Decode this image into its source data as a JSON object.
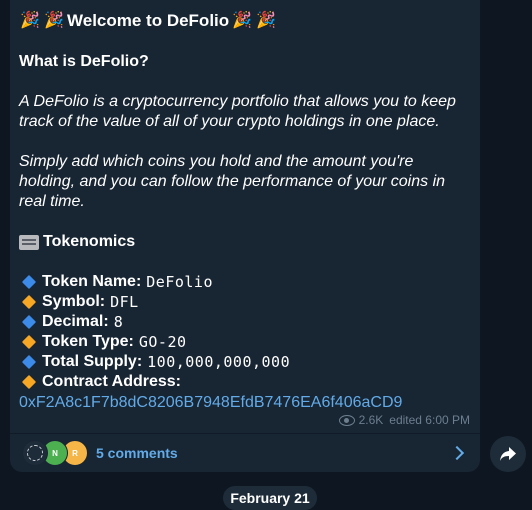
{
  "message": {
    "title_emoji": "🎉",
    "title": "Welcome to DeFolio",
    "heading": "What is DeFolio?",
    "para1": [
      "A DeFolio is a cryptocurrency portfolio that allows you to keep",
      "track of the value of all of your crypto holdings in one place."
    ],
    "para2": [
      "Simply add which coins you hold and the amount you're",
      "holding, and you can follow the performance of your coins in",
      "real time."
    ],
    "section_title": "Tokenomics",
    "token_info": [
      {
        "label": "Token Name:",
        "value": "DeFolio",
        "icon": "blue-diamond-icon",
        "color": "#3d8be8"
      },
      {
        "label": "Symbol:",
        "value": "DFL",
        "icon": "orange-diamond-icon",
        "color": "#f6a724"
      },
      {
        "label": "Decimal:",
        "value": "8",
        "icon": "blue-diamond-icon",
        "color": "#3d8be8"
      },
      {
        "label": "Token Type:",
        "value": "GO-20",
        "icon": "orange-diamond-icon",
        "color": "#f6a724"
      },
      {
        "label": "Total Supply:",
        "value": "100,000,000,000",
        "icon": "blue-diamond-icon",
        "color": "#3d8be8"
      },
      {
        "label": "Contract Address:",
        "value": "",
        "icon": "orange-diamond-icon",
        "color": "#f6a724"
      }
    ],
    "contract_address": "0xF2A8c1F7b8dC8206B7948EfdB7476EA6f406aCD9",
    "views": "2.6K",
    "edited": "edited 6:00 PM"
  },
  "comments": {
    "label": "5 comments",
    "avatars": [
      {
        "initial": "",
        "color": "#1e2b38"
      },
      {
        "initial": "N",
        "color": "#4caf50"
      },
      {
        "initial": "R",
        "color": "#f5b547"
      }
    ]
  },
  "date_separator": "February 21",
  "colors": {
    "background": "#0e1621",
    "bubble": "#182533",
    "link": "#62abe8",
    "meta": "#6d7f8f"
  }
}
